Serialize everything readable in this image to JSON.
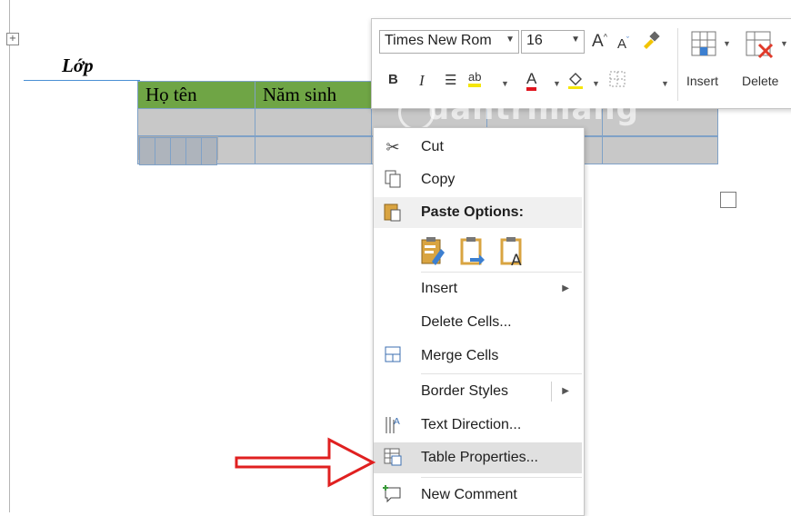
{
  "document": {
    "heading": "Lớp",
    "table": {
      "header": [
        "Họ tên",
        "Năm sinh",
        "",
        "",
        ""
      ],
      "rows": [
        [
          "",
          "",
          "",
          "",
          ""
        ],
        [
          "",
          "",
          "",
          "",
          ""
        ],
        [
          "",
          "",
          "",
          "",
          ""
        ]
      ]
    }
  },
  "toolbar": {
    "font_name": "Times New Rom",
    "font_size": "16",
    "insert_label": "Insert",
    "delete_label": "Delete",
    "bold": "B",
    "italic": "I",
    "grow_font": "A",
    "shrink_font": "A",
    "font_color_letter": "A",
    "highlight_text": "ab"
  },
  "watermark": "uantrimang",
  "context_menu": {
    "items": [
      {
        "label": "Cut",
        "icon": "scissors-icon"
      },
      {
        "label": "Copy",
        "icon": "copy-icon"
      },
      {
        "label": "Paste Options:",
        "icon": "clipboard-icon"
      },
      {
        "label": "Insert",
        "icon": "",
        "submenu": true
      },
      {
        "label": "Delete Cells...",
        "icon": ""
      },
      {
        "label": "Merge Cells",
        "icon": "merge-cells-icon"
      },
      {
        "label": "Border Styles",
        "icon": "",
        "submenu": true
      },
      {
        "label": "Text Direction...",
        "icon": "text-direction-icon"
      },
      {
        "label": "Table Properties...",
        "icon": "table-properties-icon",
        "highlighted": true
      },
      {
        "label": "New Comment",
        "icon": "comment-icon"
      }
    ],
    "paste_options": [
      "keep-source-formatting-icon",
      "merge-formatting-icon",
      "keep-text-only-icon"
    ]
  },
  "colors": {
    "header_fill": "#6fa545",
    "row_fill": "#c8c8c8",
    "highlight": "#e0e0e0",
    "arrow": "#e02020"
  }
}
